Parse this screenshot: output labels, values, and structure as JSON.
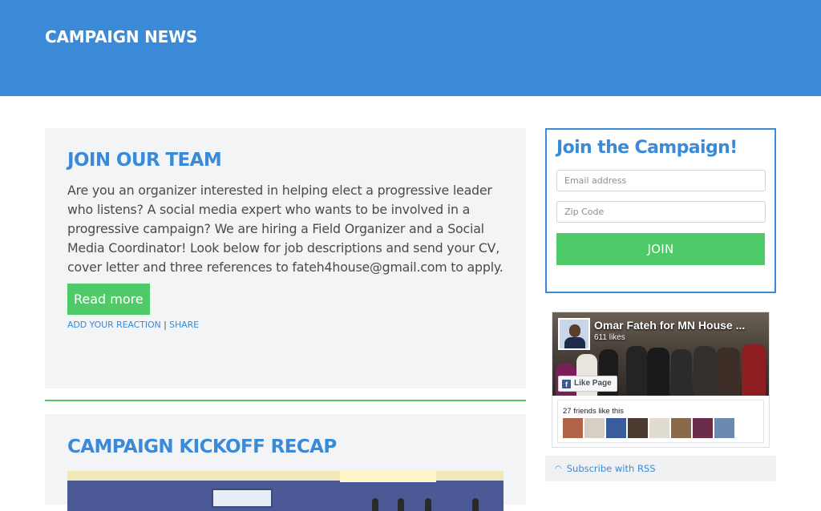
{
  "header": {
    "title": "CAMPAIGN NEWS"
  },
  "posts": [
    {
      "title": "JOIN OUR TEAM",
      "excerpt": "Are you an organizer interested in helping elect a progressive leader who listens? A social media expert who wants to be involved in a progressive campaign? We are hiring a Field Organizer and a Social Media Coordinator! Look below for job descriptions and send your CV, cover letter and three references to fateh4house@gmail.com to apply.",
      "read_more": "Read more",
      "add_reaction": "ADD YOUR REACTION",
      "separator": "|",
      "share": "SHARE"
    },
    {
      "title": "CAMPAIGN KICKOFF RECAP"
    }
  ],
  "signup": {
    "title": "Join the Campaign!",
    "email_placeholder": "Email address",
    "zip_placeholder": "Zip Code",
    "join_label": "JOIN"
  },
  "facebook": {
    "page_name": "Omar Fateh for MN House ...",
    "likes": "611 likes",
    "like_button": "Like Page",
    "friends_text": "27 friends like this",
    "f_glyph": "f"
  },
  "rss": {
    "icon": "rss-icon",
    "label": "Subscribe with RSS"
  },
  "colors": {
    "brand_blue": "#3a8ad8",
    "accent_green": "#4ecb68",
    "panel_gray": "#f3f4f6"
  }
}
